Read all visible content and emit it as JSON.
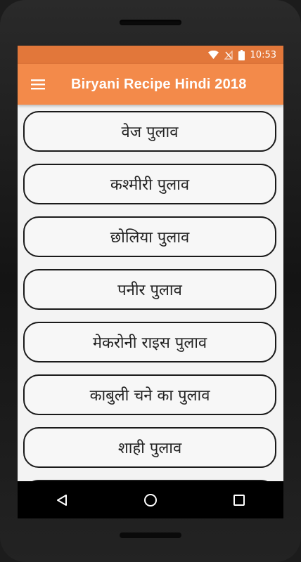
{
  "status": {
    "time": "10:53"
  },
  "app": {
    "title": "Biryani Recipe Hindi 2018"
  },
  "recipes": [
    {
      "label": "वेज पुलाव"
    },
    {
      "label": "कश्मीरी पुलाव"
    },
    {
      "label": "छोलिया पुलाव"
    },
    {
      "label": "पनीर पुलाव"
    },
    {
      "label": "मेकरोनी राइस पुलाव"
    },
    {
      "label": "काबुली चने का पुलाव"
    },
    {
      "label": "शाही पुलाव"
    },
    {
      "label": ""
    }
  ],
  "colors": {
    "statusbar": "#e2773a",
    "appbar": "#f38a4a",
    "background": "#f3f3f3",
    "item_border": "#1a1a1a"
  },
  "icons": {
    "menu": "hamburger-icon",
    "wifi": "wifi-icon",
    "signal": "no-signal-icon",
    "battery": "battery-icon",
    "back": "back-triangle-icon",
    "home": "home-circle-icon",
    "recents": "recents-square-icon"
  }
}
